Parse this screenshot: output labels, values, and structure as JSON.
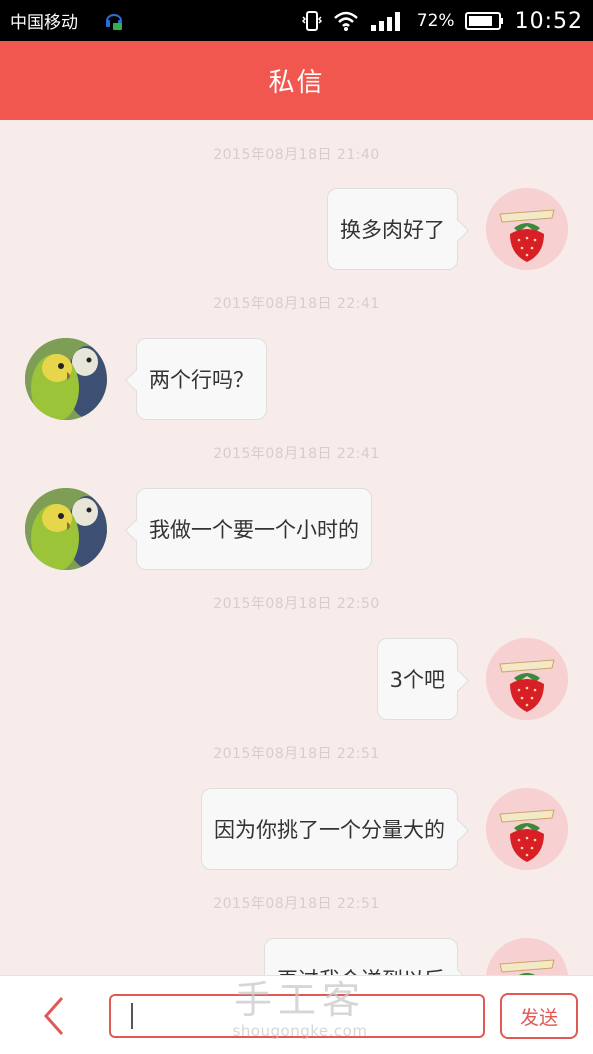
{
  "status_bar": {
    "carrier": "中国移动",
    "battery_percent": "72%",
    "time": "10:52",
    "icons": [
      "notification-headset-icon",
      "vibrate-icon",
      "wifi-icon",
      "signal-icon",
      "battery-icon"
    ]
  },
  "header": {
    "title": "私信"
  },
  "messages": [
    {
      "timestamp": "2015年08月18日 21:40",
      "sender": "me",
      "text": "换多肉好了"
    },
    {
      "timestamp": "2015年08月18日 22:41",
      "sender": "them",
      "text": "两个行吗？"
    },
    {
      "timestamp": "2015年08月18日 22:41",
      "sender": "them",
      "text": "我做一个要一个小时的"
    },
    {
      "timestamp": "2015年08月18日 22:50",
      "sender": "me",
      "text": "3个吧"
    },
    {
      "timestamp": "2015年08月18日 22:51",
      "sender": "me",
      "text": "因为你挑了一个分量大的"
    },
    {
      "timestamp": "2015年08月18日 22:51",
      "sender": "me",
      "text": "再过我会送到以后"
    }
  ],
  "input_bar": {
    "input_value": "",
    "send_label": "发送"
  },
  "watermark": {
    "main": "手工客",
    "sub": "shougongke.com"
  },
  "colors": {
    "accent": "#f2574f",
    "chat_bg": "#f7ecea",
    "bubble_bg": "#f8f8f8"
  }
}
